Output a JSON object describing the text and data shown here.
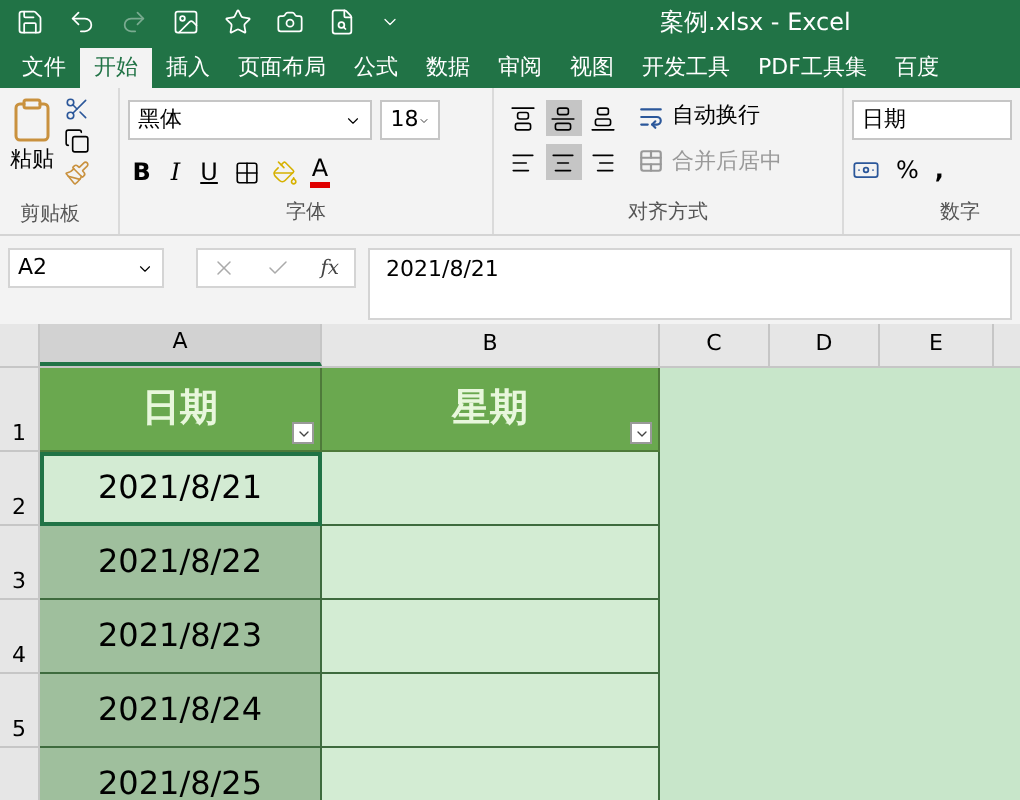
{
  "window": {
    "title": "案例.xlsx - Excel"
  },
  "tabs": [
    {
      "label": "文件",
      "selected": false
    },
    {
      "label": "开始",
      "selected": true
    },
    {
      "label": "插入",
      "selected": false
    },
    {
      "label": "页面布局",
      "selected": false
    },
    {
      "label": "公式",
      "selected": false
    },
    {
      "label": "数据",
      "selected": false
    },
    {
      "label": "审阅",
      "selected": false
    },
    {
      "label": "视图",
      "selected": false
    },
    {
      "label": "开发工具",
      "selected": false
    },
    {
      "label": "PDF工具集",
      "selected": false
    },
    {
      "label": "百度",
      "selected": false
    }
  ],
  "ribbon": {
    "clipboard": {
      "paste": "粘贴",
      "label": "剪贴板"
    },
    "font": {
      "family": "黑体",
      "size": "18",
      "label": "字体",
      "bold": "B",
      "italic": "I",
      "underline": "U",
      "font_color_letter": "A"
    },
    "alignment": {
      "label": "对齐方式",
      "wrap_text": "自动换行",
      "merge_center": "合并后居中",
      "vertical": [
        {
          "selected": false
        },
        {
          "selected": true
        },
        {
          "selected": false
        }
      ],
      "horizontal": [
        {
          "selected": false
        },
        {
          "selected": true
        },
        {
          "selected": false
        }
      ]
    },
    "number": {
      "label": "数字",
      "format": "日期",
      "percent": "%",
      "comma": ","
    }
  },
  "formula_bar": {
    "name_box": "A2",
    "fx": "fx",
    "value": "2021/8/21"
  },
  "columns": [
    "A",
    "B",
    "C",
    "D",
    "E"
  ],
  "header_row": {
    "number": "1",
    "cells": [
      "日期",
      "星期"
    ]
  },
  "rows": [
    {
      "number": "2",
      "date": "2021/8/21",
      "active": true,
      "selected": true
    },
    {
      "number": "3",
      "date": "2021/8/22",
      "active": false,
      "selected": true
    },
    {
      "number": "4",
      "date": "2021/8/23",
      "active": false,
      "selected": true
    },
    {
      "number": "5",
      "date": "2021/8/24",
      "active": false,
      "selected": true
    },
    {
      "date": "2021/8/25",
      "active": false,
      "selected": true
    }
  ]
}
